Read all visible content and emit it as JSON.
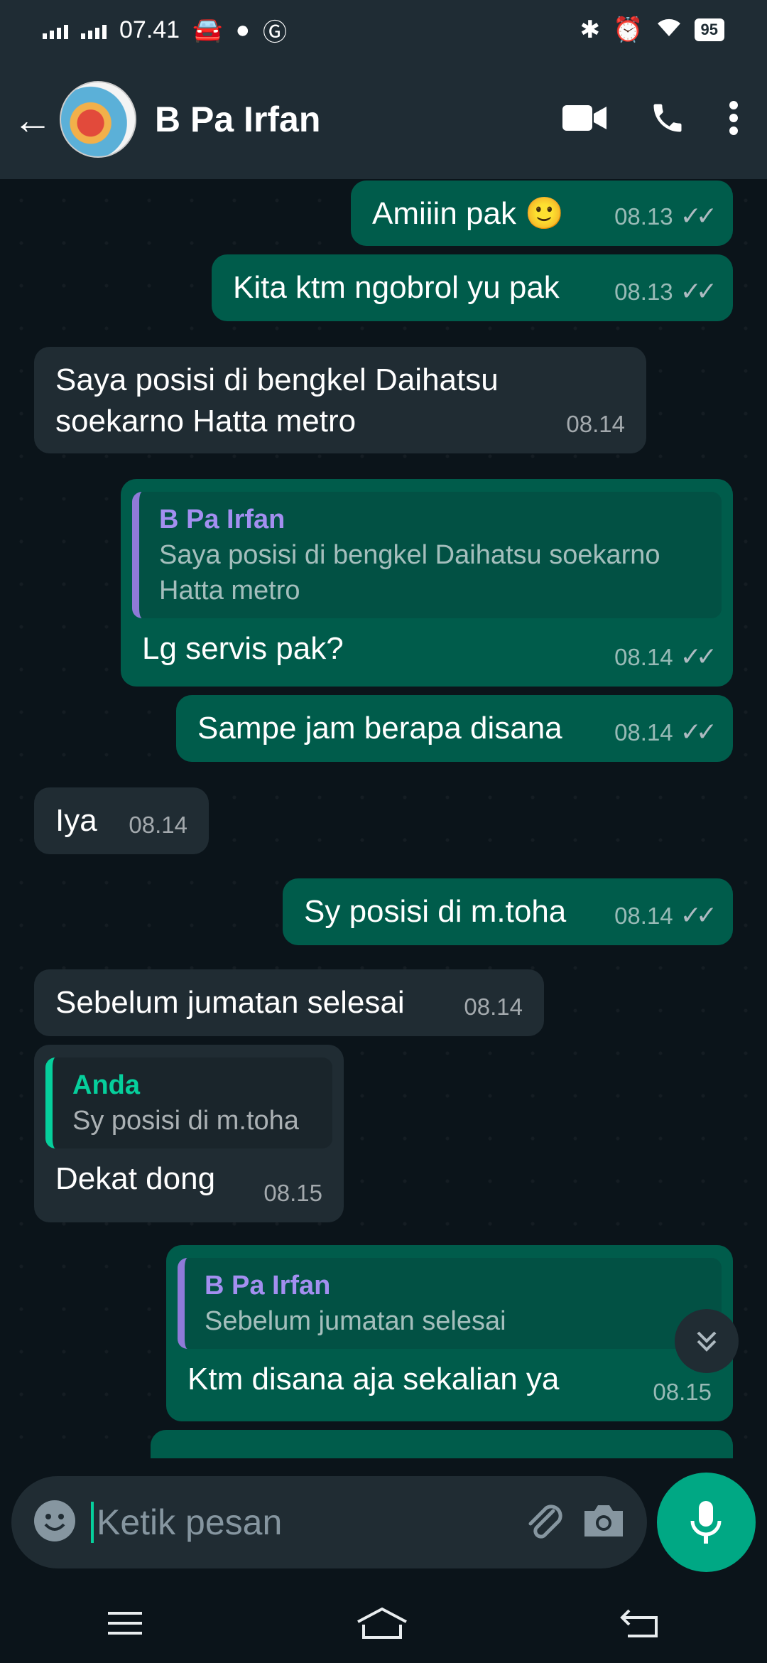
{
  "status_bar": {
    "time": "07.41",
    "battery": "95"
  },
  "header": {
    "contact_name": "B Pa Irfan"
  },
  "messages": [
    {
      "dir": "out",
      "text": "Amiiin pak",
      "emoji": "🙂",
      "time": "08.13"
    },
    {
      "dir": "out",
      "text": "Kita ktm ngobrol yu pak",
      "time": "08.13"
    },
    {
      "dir": "in",
      "text": "Saya posisi di bengkel Daihatsu soekarno Hatta metro",
      "time": "08.14"
    },
    {
      "dir": "out",
      "quote_name": "B Pa Irfan",
      "quote_text": "Saya posisi di bengkel Daihatsu soekarno Hatta metro",
      "text": "Lg servis pak?",
      "time": "08.14"
    },
    {
      "dir": "out",
      "text": "Sampe jam berapa disana",
      "time": "08.14"
    },
    {
      "dir": "in",
      "text": "Iya",
      "time": "08.14"
    },
    {
      "dir": "out",
      "text": "Sy posisi di m.toha",
      "time": "08.14"
    },
    {
      "dir": "in",
      "text": "Sebelum jumatan selesai",
      "time": "08.14"
    },
    {
      "dir": "in",
      "quote_name": "Anda",
      "quote_text": "Sy posisi di m.toha",
      "text": "Dekat dong",
      "time": "08.15"
    },
    {
      "dir": "out",
      "quote_name": "B Pa Irfan",
      "quote_text": "Sebelum jumatan selesai",
      "text": "Ktm disana aja sekalian ya",
      "time": "08.15"
    }
  ],
  "composer": {
    "placeholder": "Ketik pesan"
  }
}
